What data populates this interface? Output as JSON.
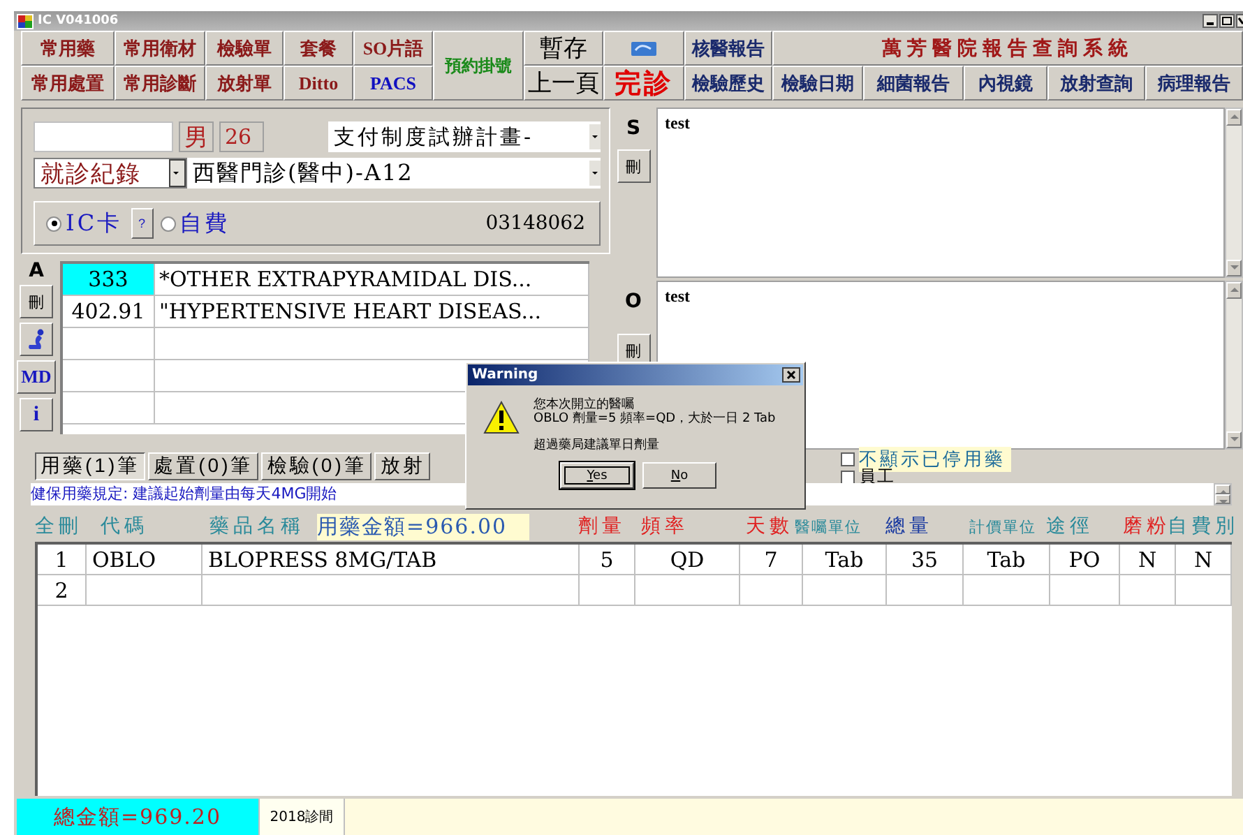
{
  "window": {
    "title": "IC V041006"
  },
  "toolbar": [
    {
      "kind": "pair",
      "top": {
        "label": "常用藥",
        "color": "#8b1a1a"
      },
      "bottom": {
        "label": "常用處置",
        "color": "#8b1a1a"
      }
    },
    {
      "kind": "pair",
      "top": {
        "label": "常用衛材",
        "color": "#8b1a1a"
      },
      "bottom": {
        "label": "常用診斷",
        "color": "#8b1a1a"
      }
    },
    {
      "kind": "pair",
      "top": {
        "label": "檢驗單",
        "color": "#8b1a1a"
      },
      "bottom": {
        "label": "放射單",
        "color": "#8b1a1a"
      }
    },
    {
      "kind": "pair",
      "top": {
        "label": "套餐",
        "color": "#8b1a1a"
      },
      "bottom": {
        "label": "Ditto",
        "color": "#8b1a1a"
      }
    },
    {
      "kind": "pair",
      "top": {
        "label": "SO片語",
        "color": "#8b1a1a"
      },
      "bottom": {
        "label": "PACS",
        "color": "#1010c0"
      }
    },
    {
      "kind": "tall",
      "label": "預約掛號",
      "color": "#1a8a1a"
    },
    {
      "kind": "big",
      "top": {
        "label": "暫存",
        "color": "#000000"
      },
      "bottom": {
        "label": "上一頁",
        "color": "#000000"
      }
    },
    {
      "kind": "icon",
      "bottom": {
        "label": "完診",
        "color": "#e00000"
      }
    },
    {
      "kind": "pair",
      "top": {
        "label": "核醫報告",
        "color": "#1a2a6c"
      },
      "bottom": {
        "label": "檢驗歷史",
        "color": "#1a2a6c"
      }
    }
  ],
  "reports": {
    "title": "萬芳醫院報告查詢系統",
    "buttons": [
      "檢驗日期",
      "細菌報告",
      "內視鏡",
      "放射查詢",
      "病理報告"
    ]
  },
  "patient": {
    "gender": "男",
    "age": "26",
    "plan": "支付制度試辦計畫-",
    "record_type": "就診紀錄",
    "clinic": "西醫門診(醫中)-A12",
    "help_button": "?",
    "card_number": "03148062",
    "payment": [
      {
        "label": "IC卡",
        "selected": true
      },
      {
        "label": "自費",
        "selected": false
      }
    ]
  },
  "diagnoses": {
    "label": "A",
    "tools": [
      {
        "kind": "text",
        "label": "刪"
      },
      {
        "kind": "icon"
      },
      {
        "kind": "text",
        "label": "MD"
      },
      {
        "kind": "info",
        "label": "i"
      }
    ],
    "rows": [
      {
        "code": "333",
        "name": "*OTHER EXTRAPYRAMIDAL DIS...",
        "selected": true
      },
      {
        "code": "402.91",
        "name": "\"HYPERTENSIVE HEART DISEAS...",
        "selected": false
      }
    ]
  },
  "notes": [
    {
      "label": "S",
      "delete": "刪",
      "text": "test"
    },
    {
      "label": "O",
      "delete": "刪",
      "text": "test"
    }
  ],
  "order_tabs": [
    {
      "label": "用藥(1)筆",
      "selected": true
    },
    {
      "label": "處置(0)筆",
      "selected": false
    },
    {
      "label": "檢驗(0)筆",
      "selected": false
    },
    {
      "label": "放射",
      "selected": false
    }
  ],
  "filters": [
    {
      "label": "不顯示已停用藥",
      "checked": false,
      "kind": "highlighted"
    },
    {
      "label": "員工",
      "checked": false,
      "kind": "plain"
    }
  ],
  "rule_notice": "健保用藥規定: 建議起始劑量由每天4MG開始",
  "orders": {
    "headers": [
      {
        "label": "全刪",
        "kind": "label",
        "color": "#2a8a9a"
      },
      {
        "label": "代碼",
        "kind": "label",
        "color": "#2a8a9a"
      },
      {
        "label": "藥品名稱",
        "kind": "label",
        "color": "#2a8a9a"
      },
      {
        "label": "用藥金額=966.00",
        "kind": "amount",
        "color": "#2a5ab0"
      },
      {
        "label": "劑量",
        "kind": "label",
        "color": "#e02020"
      },
      {
        "label": "頻率",
        "kind": "label",
        "color": "#e02020"
      },
      {
        "label": "天數",
        "kind": "label",
        "color": "#e02020"
      },
      {
        "label": "醫囑單位",
        "kind": "small",
        "color": "#2a8a9a"
      },
      {
        "label": "總量",
        "kind": "label",
        "color": "#1a3aa0"
      },
      {
        "label": "計價單位",
        "kind": "small",
        "color": "#2a8a9a"
      },
      {
        "label": "途徑",
        "kind": "label",
        "color": "#2a8a9a"
      },
      {
        "label": "磨粉",
        "kind": "label",
        "color": "#e02020"
      },
      {
        "label": "自費別",
        "kind": "label",
        "color": "#2a8a9a"
      }
    ],
    "rows": [
      {
        "cells": [
          "1",
          "OBLO",
          "BLOPRESS 8MG/TAB",
          "5",
          "QD",
          "7",
          "Tab",
          "35",
          "Tab",
          "PO",
          "N",
          "N"
        ]
      },
      {
        "cells": [
          "2"
        ]
      }
    ]
  },
  "totals": {
    "total": "總金額=969.20",
    "room": "2018診間"
  },
  "dialog": {
    "title": "Warning",
    "lines": [
      "您本次開立的醫囑",
      "OBLO 劑量=5 頻率=QD，大於一日 2 Tab"
    ],
    "note": "超過藥局建議單日劑量",
    "buttons": [
      {
        "label": "Yes",
        "selected": true
      },
      {
        "label": "No",
        "selected": false
      }
    ]
  }
}
